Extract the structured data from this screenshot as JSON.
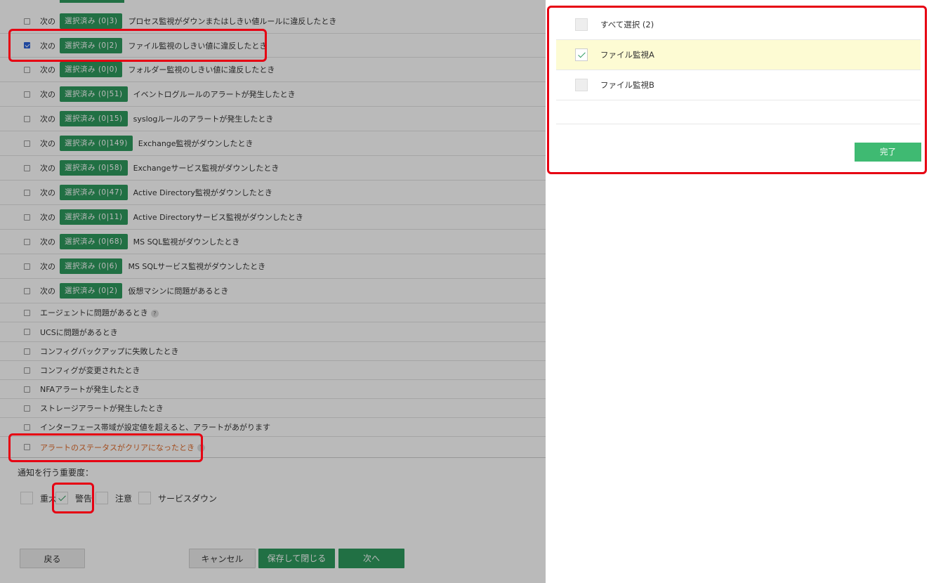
{
  "rules": [
    {
      "next": "次の",
      "selected": "選択済み (0|3)",
      "text": "プロセス監視がダウンまたはしきい値ルールに違反したとき",
      "checked": false
    },
    {
      "next": "次の",
      "selected": "選択済み (0|2)",
      "text": "ファイル監視のしきい値に違反したとき",
      "checked": true
    },
    {
      "next": "次の",
      "selected": "選択済み (0|0)",
      "text": "フォルダー監視のしきい値に違反したとき",
      "checked": false
    },
    {
      "next": "次の",
      "selected": "選択済み (0|51)",
      "text": "イベントログルールのアラートが発生したとき",
      "checked": false
    },
    {
      "next": "次の",
      "selected": "選択済み (0|15)",
      "text": "syslogルールのアラートが発生したとき",
      "checked": false
    },
    {
      "next": "次の",
      "selected": "選択済み (0|149)",
      "text": "Exchange監視がダウンしたとき",
      "checked": false
    },
    {
      "next": "次の",
      "selected": "選択済み (0|58)",
      "text": "Exchangeサービス監視がダウンしたとき",
      "checked": false
    },
    {
      "next": "次の",
      "selected": "選択済み (0|47)",
      "text": "Active Directory監視がダウンしたとき",
      "checked": false
    },
    {
      "next": "次の",
      "selected": "選択済み (0|11)",
      "text": "Active Directoryサービス監視がダウンしたとき",
      "checked": false
    },
    {
      "next": "次の",
      "selected": "選択済み (0|68)",
      "text": "MS SQL監視がダウンしたとき",
      "checked": false
    },
    {
      "next": "次の",
      "selected": "選択済み (0|6)",
      "text": "MS SQLサービス監視がダウンしたとき",
      "checked": false
    },
    {
      "next": "次の",
      "selected": "選択済み (0|2)",
      "text": "仮想マシンに問題があるとき",
      "checked": false
    }
  ],
  "plain_rules": [
    {
      "text": "エージェントに問題があるとき",
      "help": "?"
    },
    {
      "text": "UCSに問題があるとき"
    },
    {
      "text": "コンフィグバックアップに失敗したとき"
    },
    {
      "text": "コンフィグが変更されたとき"
    },
    {
      "text": "NFAアラートが発生したとき"
    },
    {
      "text": "ストレージアラートが発生したとき"
    },
    {
      "text": "インターフェース帯域が設定値を超えると、アラートがあがります"
    },
    {
      "text": "アラートのステータスがクリアになったとき",
      "help": "?"
    }
  ],
  "severity": {
    "title": "通知を行う重要度：",
    "items": [
      {
        "label": "重大",
        "checked": false
      },
      {
        "label": "警告",
        "checked": true
      },
      {
        "label": "注意",
        "checked": false
      },
      {
        "label": "サービスダウン",
        "checked": false
      }
    ]
  },
  "buttons": {
    "back": "戻る",
    "cancel": "キャンセル",
    "save_close": "保存して閉じる",
    "next": "次へ"
  },
  "panel": {
    "select_all": "すべて選択 (2)",
    "items": [
      {
        "label": "ファイル監視A",
        "checked": true
      },
      {
        "label": "ファイル監視B",
        "checked": false
      }
    ],
    "done": "完了"
  },
  "colors": {
    "accent_green": "#2e9a5e",
    "done_green": "#3fba72",
    "highlight_red": "#e60012",
    "row_highlight": "#fdfbd3",
    "warning_text": "#e06a2a"
  }
}
